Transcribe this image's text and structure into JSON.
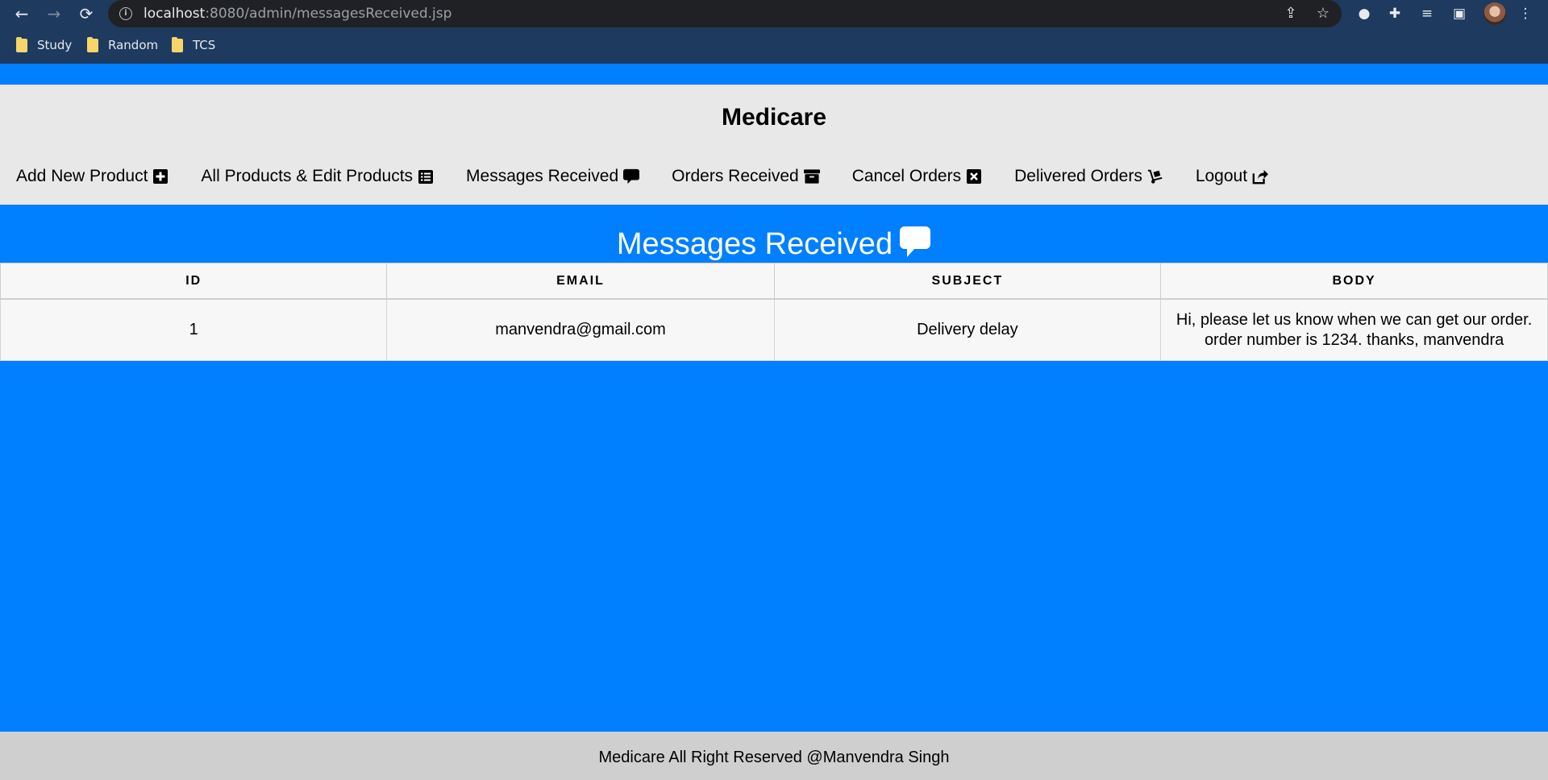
{
  "browser": {
    "url_host": "localhost",
    "url_path": ":8080/admin/messagesReceived.jsp",
    "bookmarks": [
      {
        "label": "Study"
      },
      {
        "label": "Random"
      },
      {
        "label": "TCS"
      }
    ]
  },
  "header": {
    "brand": "Medicare",
    "menu": [
      {
        "label": "Add New Product",
        "icon": "plus-square-icon"
      },
      {
        "label": "All Products & Edit Products",
        "icon": "list-alt-icon"
      },
      {
        "label": "Messages Received",
        "icon": "comment-icon"
      },
      {
        "label": "Orders Received",
        "icon": "archive-icon"
      },
      {
        "label": "Cancel Orders",
        "icon": "window-close-icon"
      },
      {
        "label": "Delivered Orders",
        "icon": "dolly-icon"
      },
      {
        "label": "Logout",
        "icon": "share-square-icon"
      }
    ]
  },
  "main": {
    "title": "Messages Received",
    "table": {
      "columns": [
        "ID",
        "EMAIL",
        "SUBJECT",
        "BODY"
      ],
      "rows": [
        {
          "id": "1",
          "email": "manvendra@gmail.com",
          "subject": "Delivery delay",
          "body": "Hi, please let us know when we can get our order. order number is 1234. thanks, manvendra"
        }
      ]
    }
  },
  "footer": {
    "text": "Medicare All Right Reserved @Manvendra Singh"
  },
  "colors": {
    "page_background": "#007fff",
    "header_background": "#e8e8e8",
    "footer_background": "#cfcfcf",
    "table_background": "#f7f7f7"
  }
}
